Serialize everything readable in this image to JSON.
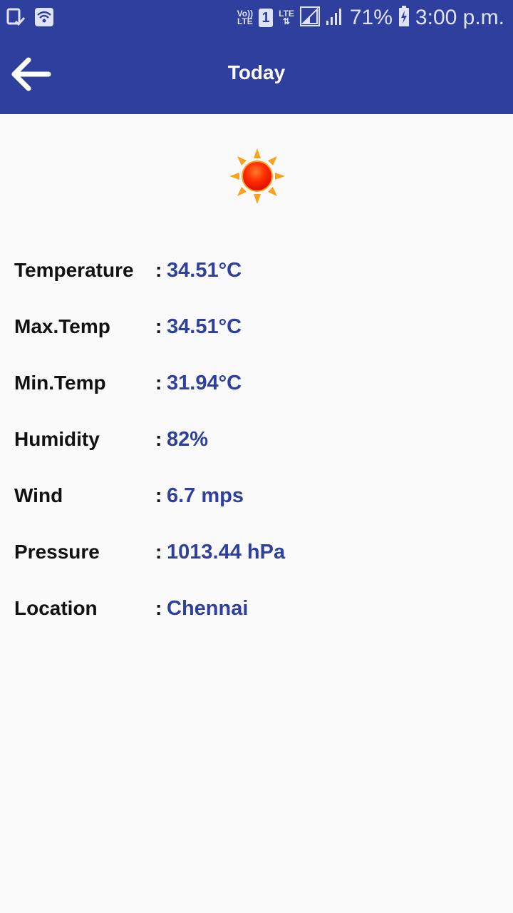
{
  "status_bar": {
    "volte_top": "Vo))",
    "volte_bottom": "LTE",
    "sim": "1",
    "lte": "LTE",
    "battery_percent": "71%",
    "time": "3:00 p.m."
  },
  "app_bar": {
    "title": "Today"
  },
  "weather_icon": "sun-icon",
  "details": [
    {
      "label": "Temperature",
      "colon": ":",
      "value": "34.51°C"
    },
    {
      "label": "Max.Temp",
      "colon": ":",
      "value": "34.51°C"
    },
    {
      "label": "Min.Temp",
      "colon": ":",
      "value": "31.94°C"
    },
    {
      "label": "Humidity",
      "colon": ":",
      "value": "82%"
    },
    {
      "label": "Wind",
      "colon": ":",
      "value": "6.7 mps"
    },
    {
      "label": "Pressure",
      "colon": ":",
      "value": "1013.44 hPa"
    },
    {
      "label": "Location",
      "colon": ":",
      "value": "Chennai"
    }
  ],
  "colors": {
    "primary": "#2f3f9e",
    "background": "#fafafa",
    "value_text": "#2f3f9e"
  }
}
